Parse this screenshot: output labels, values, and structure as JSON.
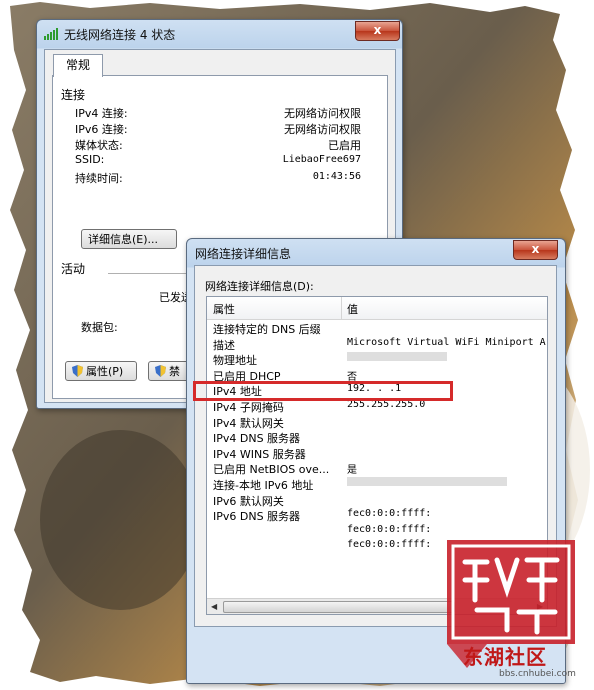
{
  "status_window": {
    "title": "无线网络连接 4 状态",
    "close": "x",
    "tab": "常规",
    "connection_section": "连接",
    "rows": [
      {
        "label": "IPv4 连接:",
        "value": "无网络访问权限"
      },
      {
        "label": "IPv6 连接:",
        "value": "无网络访问权限"
      },
      {
        "label": "媒体状态:",
        "value": "已启用"
      },
      {
        "label": "SSID:",
        "value": "LiebaoFree697"
      },
      {
        "label": "持续时间:",
        "value": "01:43:56"
      }
    ],
    "details_button": "详细信息(E)...",
    "activity_section": "活动",
    "sent_label": "已发送",
    "packets_label": "数据包:",
    "properties_button": "属性(P)",
    "disable_button": "禁"
  },
  "details_window": {
    "title": "网络连接详细信息",
    "close": "x",
    "caption": "网络连接详细信息(D):",
    "col_property": "属性",
    "col_value": "值",
    "rows": [
      {
        "prop": "连接特定的 DNS 后缀",
        "value": "",
        "blur": 0
      },
      {
        "prop": "描述",
        "value": "Microsoft Virtual WiFi Miniport A",
        "blur": 0
      },
      {
        "prop": "物理地址",
        "value": "",
        "blur": 100
      },
      {
        "prop": "已启用 DHCP",
        "value": "否",
        "blur": 0
      },
      {
        "prop": "IPv4 地址",
        "value": "192.  .  .1",
        "blur": 0
      },
      {
        "prop": "IPv4 子网掩码",
        "value": "255.255.255.0",
        "blur": 0
      },
      {
        "prop": "IPv4 默认网关",
        "value": "",
        "blur": 0
      },
      {
        "prop": "IPv4 DNS 服务器",
        "value": "",
        "blur": 0
      },
      {
        "prop": "IPv4 WINS 服务器",
        "value": "",
        "blur": 0
      },
      {
        "prop": "已启用 NetBIOS ove...",
        "value": "是",
        "blur": 0
      },
      {
        "prop": "连接-本地 IPv6 地址",
        "value": "",
        "blur": 160
      },
      {
        "prop": "IPv6 默认网关",
        "value": "",
        "blur": 0
      },
      {
        "prop": "IPv6 DNS 服务器",
        "value": "fec0:0:0:ffff:",
        "blur": 0
      },
      {
        "prop": "",
        "value": "fec0:0:0:ffff:",
        "blur": 0
      },
      {
        "prop": "",
        "value": "fec0:0:0:ffff:",
        "blur": 0
      }
    ]
  },
  "watermark": {
    "brand": "东湖社区",
    "url": "bbs.cnhubei.com"
  },
  "colors": {
    "highlight": "#d52a2a",
    "watermark": "#c01818"
  }
}
